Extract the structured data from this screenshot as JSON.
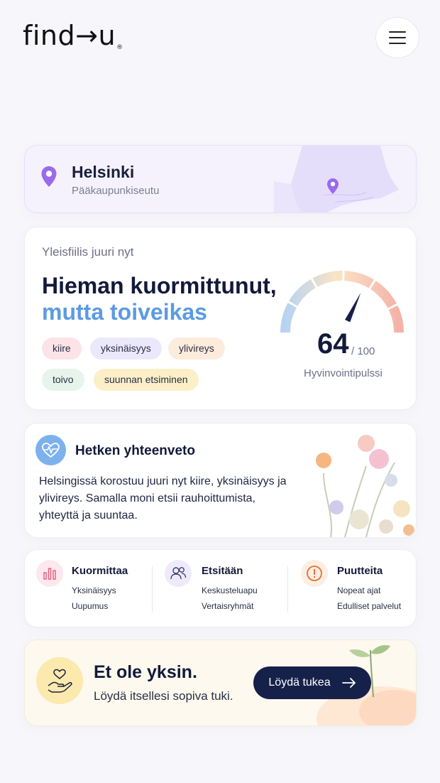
{
  "header": {
    "logo_text": "find→u",
    "logo_reg": "®",
    "menu_icon": "hamburger-menu-icon"
  },
  "location": {
    "city": "Helsinki",
    "region": "Pääkaupunkiseutu",
    "icon": "map-pin-icon"
  },
  "mood": {
    "label": "Yleisfiilis juuri nyt",
    "headline_1": "Hieman kuormittunut,",
    "headline_2": "mutta toiveikas",
    "tags": [
      "kiire",
      "yksinäisyys",
      "ylivireys",
      "toivo",
      "suunnan etsiminen"
    ],
    "score": "64",
    "score_max": "/ 100",
    "score_value": 64,
    "gauge_label": "Hyvinvointipulssi"
  },
  "summary": {
    "title": "Hetken yhteenveto",
    "text": "Helsingissä korostuu juuri nyt kiire, yksinäisyys ja ylivireys. Samalla moni etsii rauhoittumista, yhteyttä ja suuntaa.",
    "icon": "heart-pulse-icon"
  },
  "stats": [
    {
      "title": "Kuormittaa",
      "lines": [
        "Yksinäisyys",
        "Uupumus"
      ],
      "icon": "bar-chart-icon",
      "color": "#fde8ee"
    },
    {
      "title": "Etsitään",
      "lines": [
        "Keskusteluapu",
        "Vertaisryhmät"
      ],
      "icon": "people-icon",
      "color": "#efeafb"
    },
    {
      "title": "Puutteita",
      "lines": [
        "Nopeat ajat",
        "Edulliset palvelut"
      ],
      "icon": "alert-circle-icon",
      "color": "#fdeee2"
    }
  ],
  "cta": {
    "title": "Et ole yksin.",
    "subtitle": "Löydä itsellesi sopiva tuki.",
    "button_label": "Löydä tukea",
    "icon": "heart-hand-icon",
    "button_icon": "arrow-right-icon"
  },
  "colors": {
    "accent_blue": "#5b9be2",
    "navy": "#16214a",
    "purple_pin": "#9a6bea"
  }
}
